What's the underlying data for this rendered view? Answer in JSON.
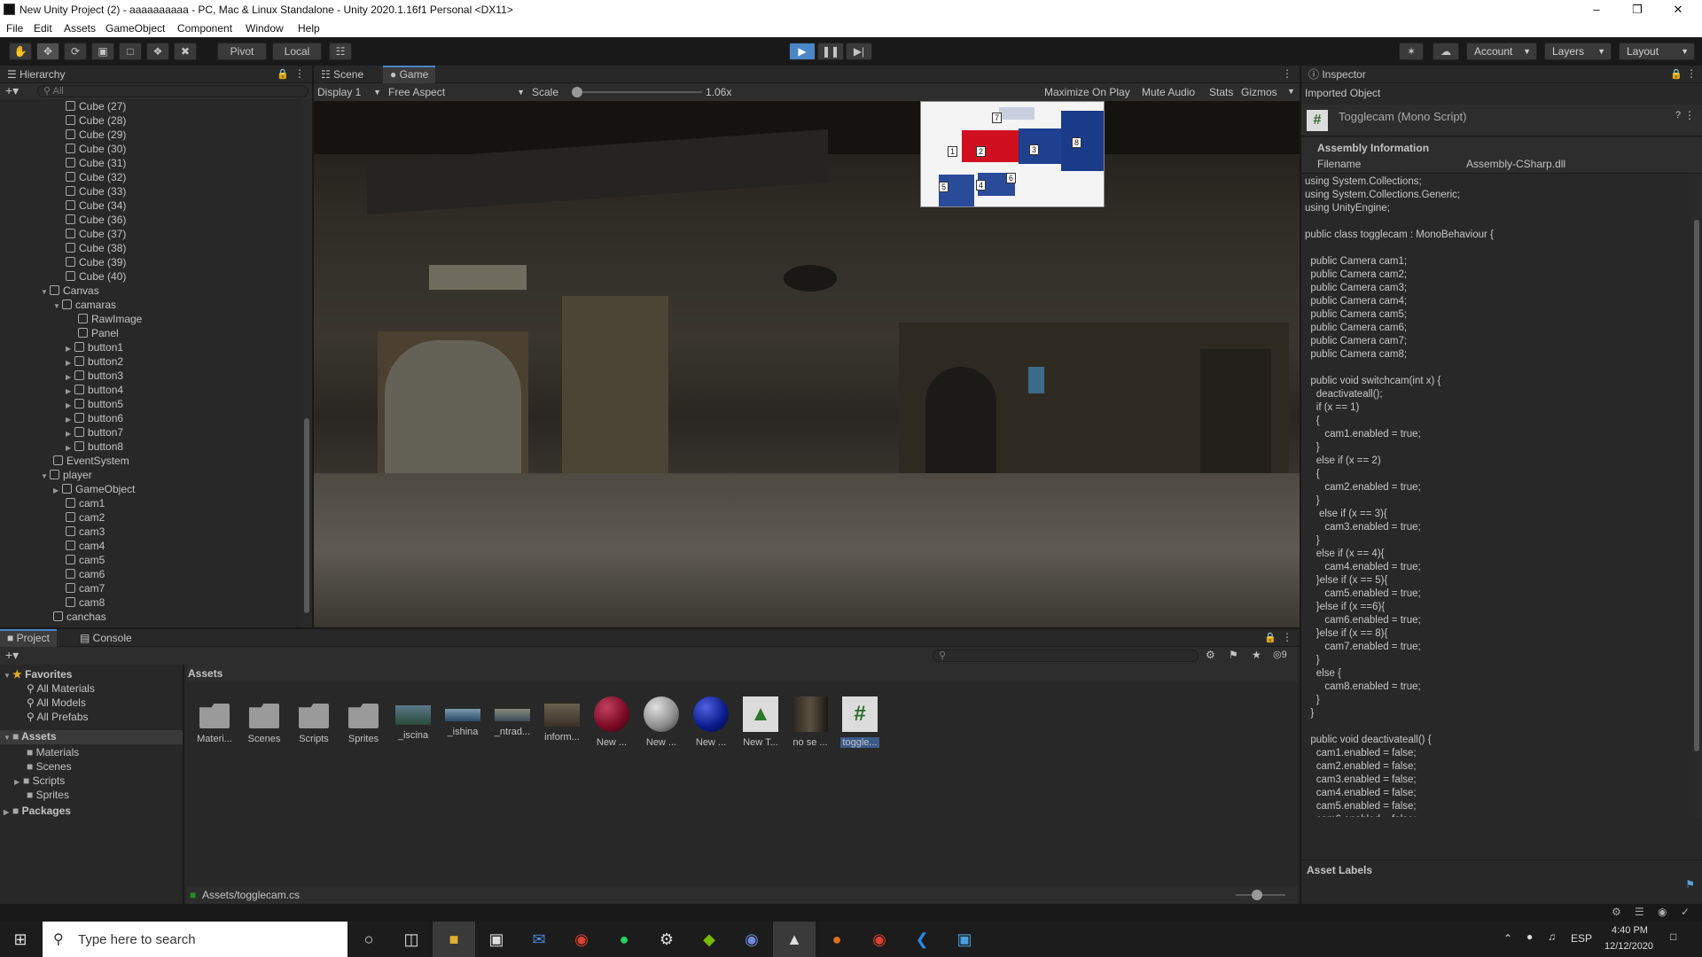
{
  "window": {
    "title": "New Unity Project (2) - aaaaaaaaaa - PC, Mac & Linux Standalone - Unity 2020.1.16f1 Personal <DX11>"
  },
  "menu": [
    "File",
    "Edit",
    "Assets",
    "GameObject",
    "Component",
    "Window",
    "Help"
  ],
  "toolbar": {
    "pivot": "Pivot",
    "local": "Local",
    "account": "Account",
    "layers": "Layers",
    "layout": "Layout"
  },
  "hierarchy": {
    "tab": "Hierarchy",
    "search_placeholder": "All",
    "rows": [
      {
        "label": "Cube (27)"
      },
      {
        "label": "Cube (28)"
      },
      {
        "label": "Cube (29)"
      },
      {
        "label": "Cube (30)"
      },
      {
        "label": "Cube (31)"
      },
      {
        "label": "Cube (32)"
      },
      {
        "label": "Cube (33)"
      },
      {
        "label": "Cube (34)"
      },
      {
        "label": "Cube (36)"
      },
      {
        "label": "Cube (37)"
      },
      {
        "label": "Cube (38)"
      },
      {
        "label": "Cube (39)"
      },
      {
        "label": "Cube (40)"
      },
      {
        "label": "Canvas"
      },
      {
        "label": "camaras"
      },
      {
        "label": "RawImage"
      },
      {
        "label": "Panel"
      },
      {
        "label": "button1"
      },
      {
        "label": "button2"
      },
      {
        "label": "button3"
      },
      {
        "label": "button4"
      },
      {
        "label": "button5"
      },
      {
        "label": "button6"
      },
      {
        "label": "button7"
      },
      {
        "label": "button8"
      },
      {
        "label": "EventSystem"
      },
      {
        "label": "player"
      },
      {
        "label": "GameObject"
      },
      {
        "label": "cam1"
      },
      {
        "label": "cam2"
      },
      {
        "label": "cam3"
      },
      {
        "label": "cam4"
      },
      {
        "label": "cam5"
      },
      {
        "label": "cam6"
      },
      {
        "label": "cam7"
      },
      {
        "label": "cam8"
      },
      {
        "label": "canchas"
      }
    ]
  },
  "game": {
    "tab_scene": "Scene",
    "tab_game": "Game",
    "display": "Display 1",
    "aspect": "Free Aspect",
    "scale_label": "Scale",
    "scale_value": "1.06x",
    "maximize": "Maximize On Play",
    "mute": "Mute Audio",
    "stats": "Stats",
    "gizmos": "Gizmos",
    "map_labels": [
      "7",
      "1",
      "2",
      "3",
      "8",
      "5",
      "4",
      "6"
    ]
  },
  "inspector": {
    "tab": "Inspector",
    "imported": "Imported Object",
    "object": "Togglecam (Mono Script)",
    "assembly_header": "Assembly Information",
    "filename_label": "Filename",
    "filename_value": "Assembly-CSharp.dll",
    "asset_labels": "Asset Labels",
    "code": "using System.Collections;\nusing System.Collections.Generic;\nusing UnityEngine;\n\npublic class togglecam : MonoBehaviour {\n\n  public Camera cam1;\n  public Camera cam2;\n  public Camera cam3;\n  public Camera cam4;\n  public Camera cam5;\n  public Camera cam6;\n  public Camera cam7;\n  public Camera cam8;\n\n  public void switchcam(int x) {\n    deactivateall();\n    if (x == 1)\n    {\n       cam1.enabled = true;\n    }\n    else if (x == 2)\n    {\n       cam2.enabled = true;\n    }\n     else if (x == 3){\n       cam3.enabled = true;\n    }\n    else if (x == 4){\n       cam4.enabled = true;\n    }else if (x == 5){\n       cam5.enabled = true;\n    }else if (x ==6){\n       cam6.enabled = true;\n    }else if (x == 8){\n       cam7.enabled = true;\n    }\n    else {\n       cam8.enabled = true;\n    }\n  }\n\n  public void deactivateall() {\n    cam1.enabled = false;\n    cam2.enabled = false;\n    cam3.enabled = false;\n    cam4.enabled = false;\n    cam5.enabled = false;\n    cam6.enabled = false;"
  },
  "project": {
    "tab_project": "Project",
    "tab_console": "Console",
    "hidden_count": "9",
    "favorites": "Favorites",
    "fav_items": [
      "All Materials",
      "All Models",
      "All Prefabs"
    ],
    "assets_root": "Assets",
    "asset_folders": [
      "Materials",
      "Scenes",
      "Scripts",
      "Sprites"
    ],
    "packages": "Packages",
    "assets_header": "Assets",
    "items": [
      {
        "label": "Materi...",
        "kind": "folder"
      },
      {
        "label": "Scenes",
        "kind": "folder"
      },
      {
        "label": "Scripts",
        "kind": "folder"
      },
      {
        "label": "Sprites",
        "kind": "folder"
      },
      {
        "label": "_iscina",
        "kind": "image"
      },
      {
        "label": "_ishina",
        "kind": "image"
      },
      {
        "label": "_ntrad...",
        "kind": "image"
      },
      {
        "label": "inform...",
        "kind": "image"
      },
      {
        "label": "New ...",
        "kind": "sphere",
        "color": "#7a0a24"
      },
      {
        "label": "New ...",
        "kind": "sphere",
        "color": "#8a8a8a"
      },
      {
        "label": "New ...",
        "kind": "sphere",
        "color": "#0a1a8a"
      },
      {
        "label": "New T...",
        "kind": "terrain"
      },
      {
        "label": "no se ...",
        "kind": "image"
      },
      {
        "label": "toggle...",
        "kind": "script"
      }
    ],
    "path": "Assets/togglecam.cs"
  },
  "taskbar": {
    "search": "Type here to search",
    "lang": "ESP",
    "time": "4:40 PM",
    "date": "12/12/2020"
  }
}
